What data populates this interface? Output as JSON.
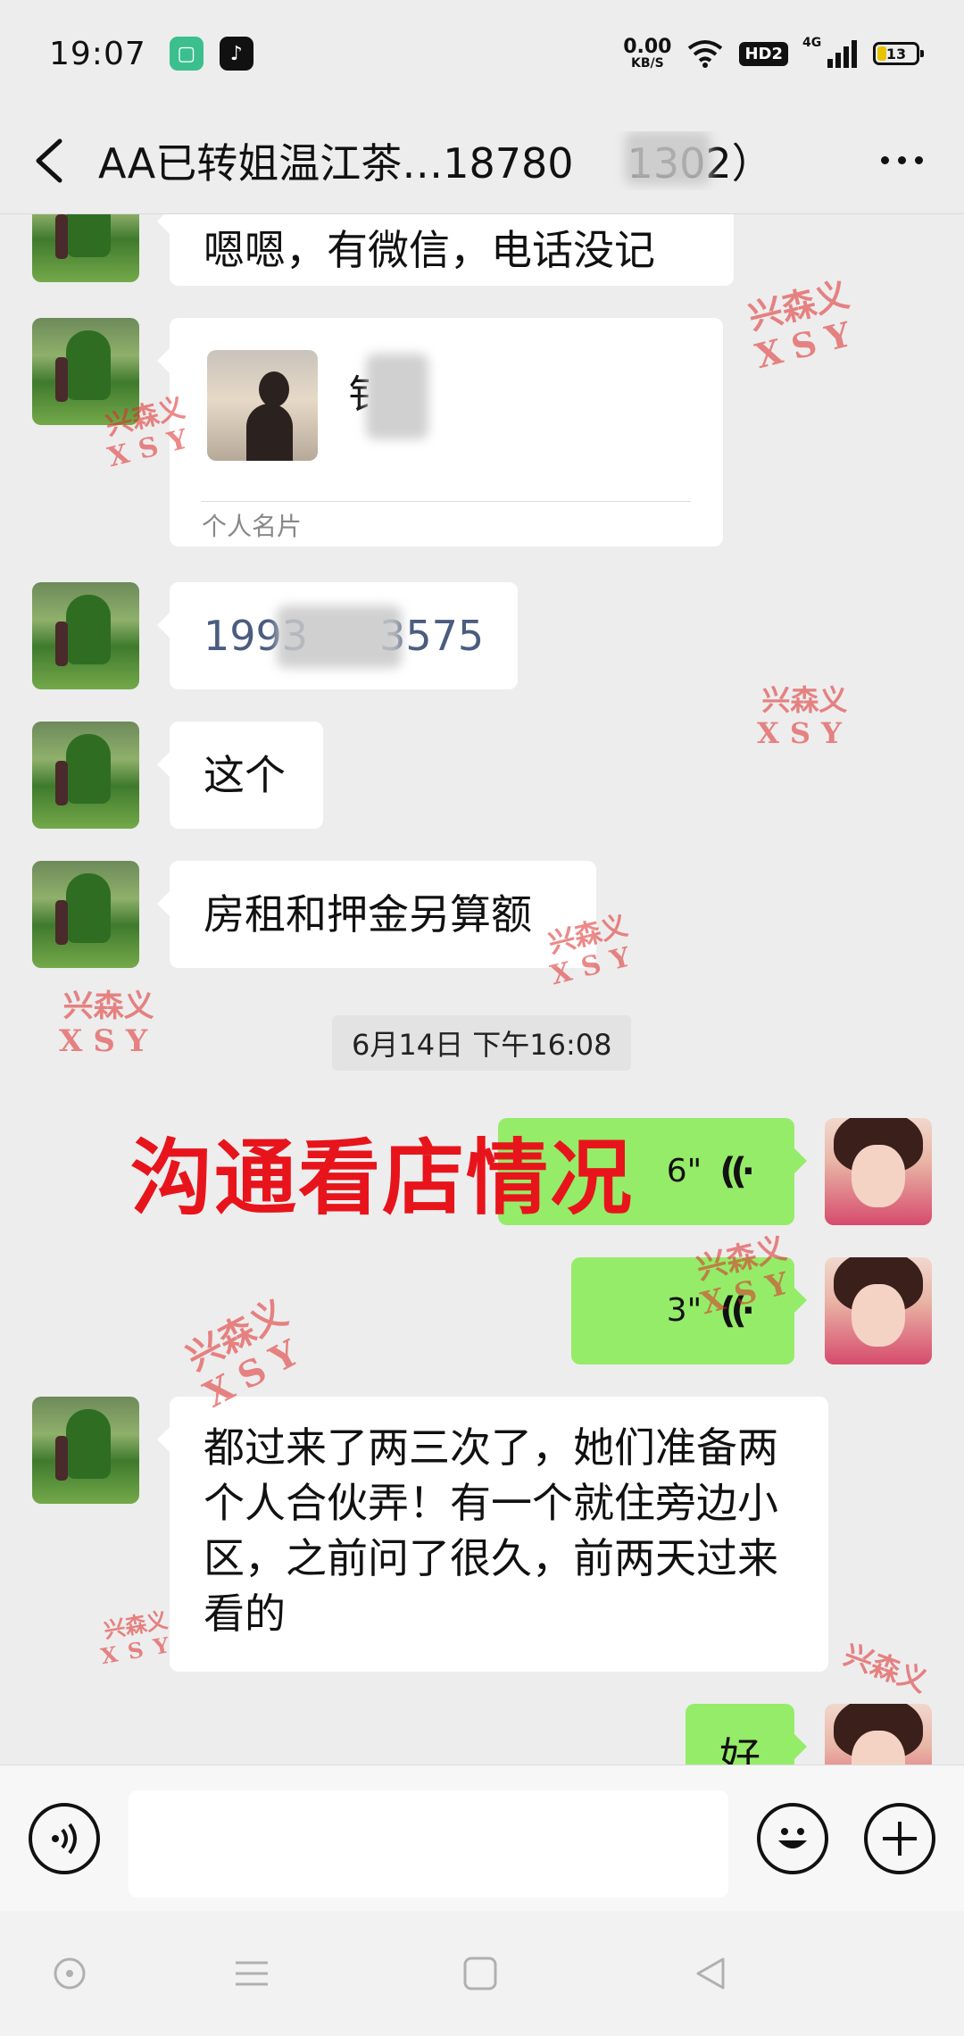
{
  "status_bar": {
    "time": "19:07",
    "net_speed_value": "0.00",
    "net_speed_unit": "KB/S",
    "hd_badge": "HD2",
    "network_label": "4G",
    "battery_level": "13"
  },
  "header": {
    "title": "AA已转姐温江茶…18780",
    "title_suffix": "1302）"
  },
  "messages": {
    "m1_text": "嗯嗯，有微信，电话没记",
    "card_name": "钅",
    "card_label": "个人名片",
    "m3_prefix": "1993",
    "m3_suffix": "3575",
    "m4_text": "这个",
    "m5_text": "房租和押金另算额",
    "time_divider": "6月14日 下午16:08",
    "voice1_duration": "6\"",
    "voice2_duration": "3\"",
    "m8_text": "都过来了两三次了，她们准备两个人合伙弄！有一个就住旁边小区，之前问了很久，前两天过来看的",
    "m9_text": "好"
  },
  "overlay": {
    "text": "沟通看店情况"
  },
  "watermark": {
    "line1": "兴森义",
    "line2": "XSY"
  },
  "input": {
    "placeholder": ""
  },
  "icons": {
    "back": "back-arrow-icon",
    "more": "more-dots-icon",
    "voice_toggle": "voice-input-icon",
    "emoji": "emoji-icon",
    "plus": "plus-icon",
    "voice_wave": "voice-wave-icon"
  },
  "colors": {
    "outgoing_bubble": "#95ec69",
    "incoming_bubble": "#ffffff",
    "overlay_text": "#e8141b",
    "background": "#ededed"
  }
}
